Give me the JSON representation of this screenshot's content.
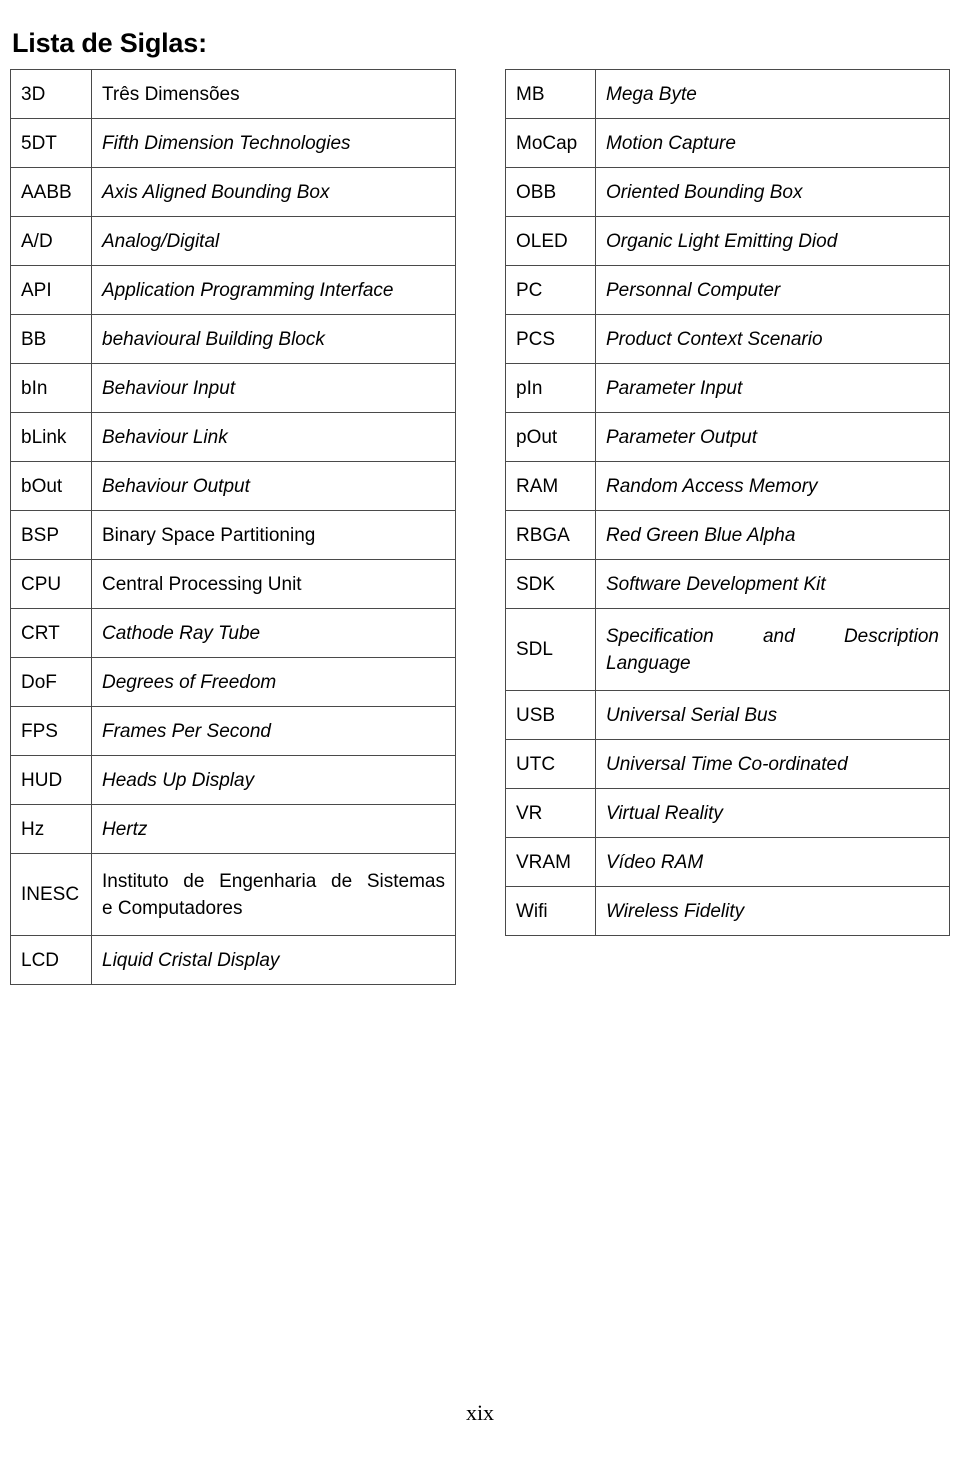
{
  "document": {
    "title": "Lista de Siglas:",
    "page_number": "xix"
  },
  "tables": {
    "left": {
      "rows": [
        {
          "abbr": "3D",
          "meaning": "Três Dimensões",
          "italic": false,
          "lines": null
        },
        {
          "abbr": "5DT",
          "meaning": "Fifth Dimension Technologies",
          "italic": true,
          "lines": null
        },
        {
          "abbr": "AABB",
          "meaning": "Axis Aligned Bounding Box",
          "italic": true,
          "lines": null
        },
        {
          "abbr": "A/D",
          "meaning": "Analog/Digital",
          "italic": true,
          "lines": null
        },
        {
          "abbr": "API",
          "meaning": "Application Programming Interface",
          "italic": true,
          "lines": null
        },
        {
          "abbr": "BB",
          "meaning": "behavioural Building Block",
          "italic": true,
          "lines": null
        },
        {
          "abbr": "bIn",
          "meaning": "Behaviour Input",
          "italic": true,
          "lines": null
        },
        {
          "abbr": "bLink",
          "meaning": "Behaviour Link",
          "italic": true,
          "lines": null
        },
        {
          "abbr": "bOut",
          "meaning": "Behaviour Output",
          "italic": true,
          "lines": null
        },
        {
          "abbr": "BSP",
          "meaning": "Binary Space Partitioning",
          "italic": false,
          "lines": null
        },
        {
          "abbr": "CPU",
          "meaning": "Central Processing Unit",
          "italic": false,
          "lines": null
        },
        {
          "abbr": "CRT",
          "meaning": "Cathode Ray Tube",
          "italic": true,
          "lines": null
        },
        {
          "abbr": "DoF",
          "meaning": "Degrees of Freedom",
          "italic": true,
          "lines": null
        },
        {
          "abbr": "FPS",
          "meaning": "Frames Per Second",
          "italic": true,
          "lines": null
        },
        {
          "abbr": "HUD",
          "meaning": "Heads Up Display",
          "italic": true,
          "lines": null
        },
        {
          "abbr": "Hz",
          "meaning": "Hertz",
          "italic": true,
          "lines": null
        },
        {
          "abbr": "INESC",
          "meaning": "Instituto de Engenharia de Sistemas e Computadores",
          "italic": false,
          "lines": [
            "Instituto de Engenharia de Sistemas",
            "e Computadores"
          ]
        },
        {
          "abbr": "LCD",
          "meaning": "Liquid Cristal Display",
          "italic": true,
          "lines": null
        }
      ]
    },
    "right": {
      "rows": [
        {
          "abbr": "MB",
          "meaning": "Mega Byte",
          "italic": true,
          "lines": null
        },
        {
          "abbr": "MoCap",
          "meaning": "Motion Capture",
          "italic": true,
          "lines": null
        },
        {
          "abbr": "OBB",
          "meaning": "Oriented Bounding Box",
          "italic": true,
          "lines": null
        },
        {
          "abbr": "OLED",
          "meaning": "Organic Light Emitting Diod",
          "italic": true,
          "lines": null
        },
        {
          "abbr": "PC",
          "meaning": "Personnal Computer",
          "italic": true,
          "lines": null
        },
        {
          "abbr": "PCS",
          "meaning": "Product Context Scenario",
          "italic": true,
          "lines": null
        },
        {
          "abbr": "pIn",
          "meaning": "Parameter Input",
          "italic": true,
          "lines": null
        },
        {
          "abbr": "pOut",
          "meaning": "Parameter Output",
          "italic": true,
          "lines": null
        },
        {
          "abbr": "RAM",
          "meaning": "Random Access Memory",
          "italic": true,
          "lines": null
        },
        {
          "abbr": "RBGA",
          "meaning": "Red Green Blue Alpha",
          "italic": true,
          "lines": null
        },
        {
          "abbr": "SDK",
          "meaning": "Software Development Kit",
          "italic": true,
          "lines": null
        },
        {
          "abbr": "SDL",
          "meaning": "Specification and Description Language",
          "italic": true,
          "lines": [
            "Specification and Description",
            "Language"
          ]
        },
        {
          "abbr": "USB",
          "meaning": "Universal Serial Bus",
          "italic": true,
          "lines": null
        },
        {
          "abbr": "UTC",
          "meaning": "Universal Time Co-ordinated",
          "italic": true,
          "lines": null
        },
        {
          "abbr": "VR",
          "meaning": "Virtual Reality",
          "italic": true,
          "lines": null
        },
        {
          "abbr": "VRAM",
          "meaning": "Vídeo RAM",
          "italic": true,
          "lines": null
        },
        {
          "abbr": "Wifi",
          "meaning": "Wireless Fidelity",
          "italic": true,
          "lines": null
        }
      ]
    }
  }
}
